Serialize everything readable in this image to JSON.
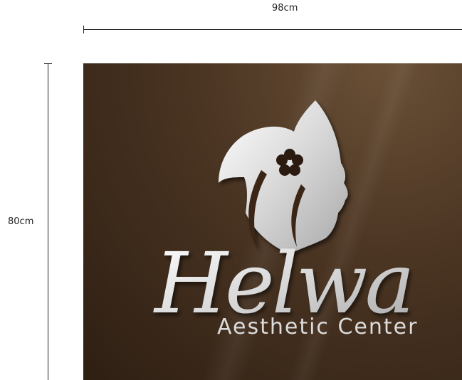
{
  "dimensions": {
    "width_label": "98cm",
    "height_label": "80cm"
  },
  "sign": {
    "brand_name": "Helwa",
    "tagline": "Aesthetic Center",
    "board_color": "#4a3422",
    "logo_color": "#e6e6e6",
    "flower_color": "#2a1a10"
  }
}
